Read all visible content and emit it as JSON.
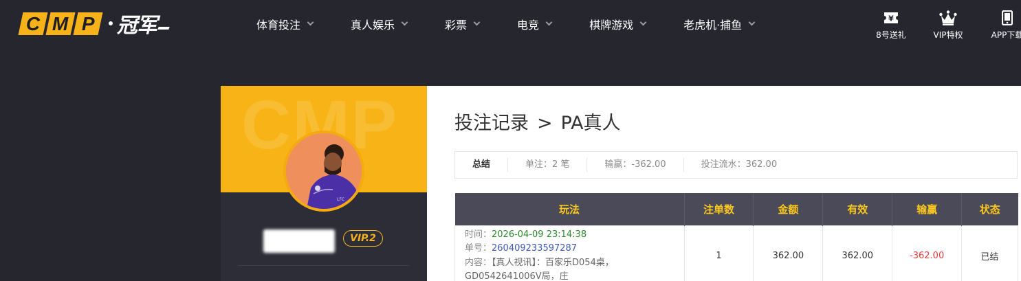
{
  "header": {
    "logo": {
      "boxes": [
        "C",
        "M",
        "P"
      ],
      "cn": "冠军"
    },
    "nav": [
      {
        "label": "体育投注"
      },
      {
        "label": "真人娱乐"
      },
      {
        "label": "彩票"
      },
      {
        "label": "电竞"
      },
      {
        "label": "棋牌游戏"
      },
      {
        "label": "老虎机·捕鱼"
      }
    ],
    "icons": [
      {
        "name": "gift-ticket-icon",
        "label": "8号送礼"
      },
      {
        "name": "crown-icon",
        "label": "VIP特权"
      },
      {
        "name": "phone-icon",
        "label": "APP下载"
      }
    ]
  },
  "profile": {
    "bg_text": "CMP",
    "vip": "VIP.2"
  },
  "main": {
    "title_part1": "投注记录",
    "title_sep": ">",
    "title_part2": "PA真人",
    "summary": {
      "title": "总结",
      "bets": "单注：2 笔",
      "winloss": "输赢：-362.00",
      "turnover": "投注流水：362.00"
    },
    "table": {
      "headers": [
        "玩法",
        "注单数",
        "金额",
        "有效",
        "输赢",
        "状态"
      ],
      "rows": [
        {
          "time_label": "时间：",
          "time": "2026-04-09 23:14:38",
          "no_label": "单号：",
          "no": "260409233597287",
          "content_label": "内容：",
          "content_line1": "【真人视讯】：百家乐D054桌，",
          "content_line2": "GD0542641006V局，庄",
          "count": "1",
          "amount": "362.00",
          "valid": "362.00",
          "winloss": "-362.00",
          "status": "已结"
        }
      ]
    }
  },
  "colors": {
    "bg": "#26262f",
    "accent": "#f7b21a",
    "header_cell": "#4a4a58",
    "loss": "#e23b3b"
  }
}
